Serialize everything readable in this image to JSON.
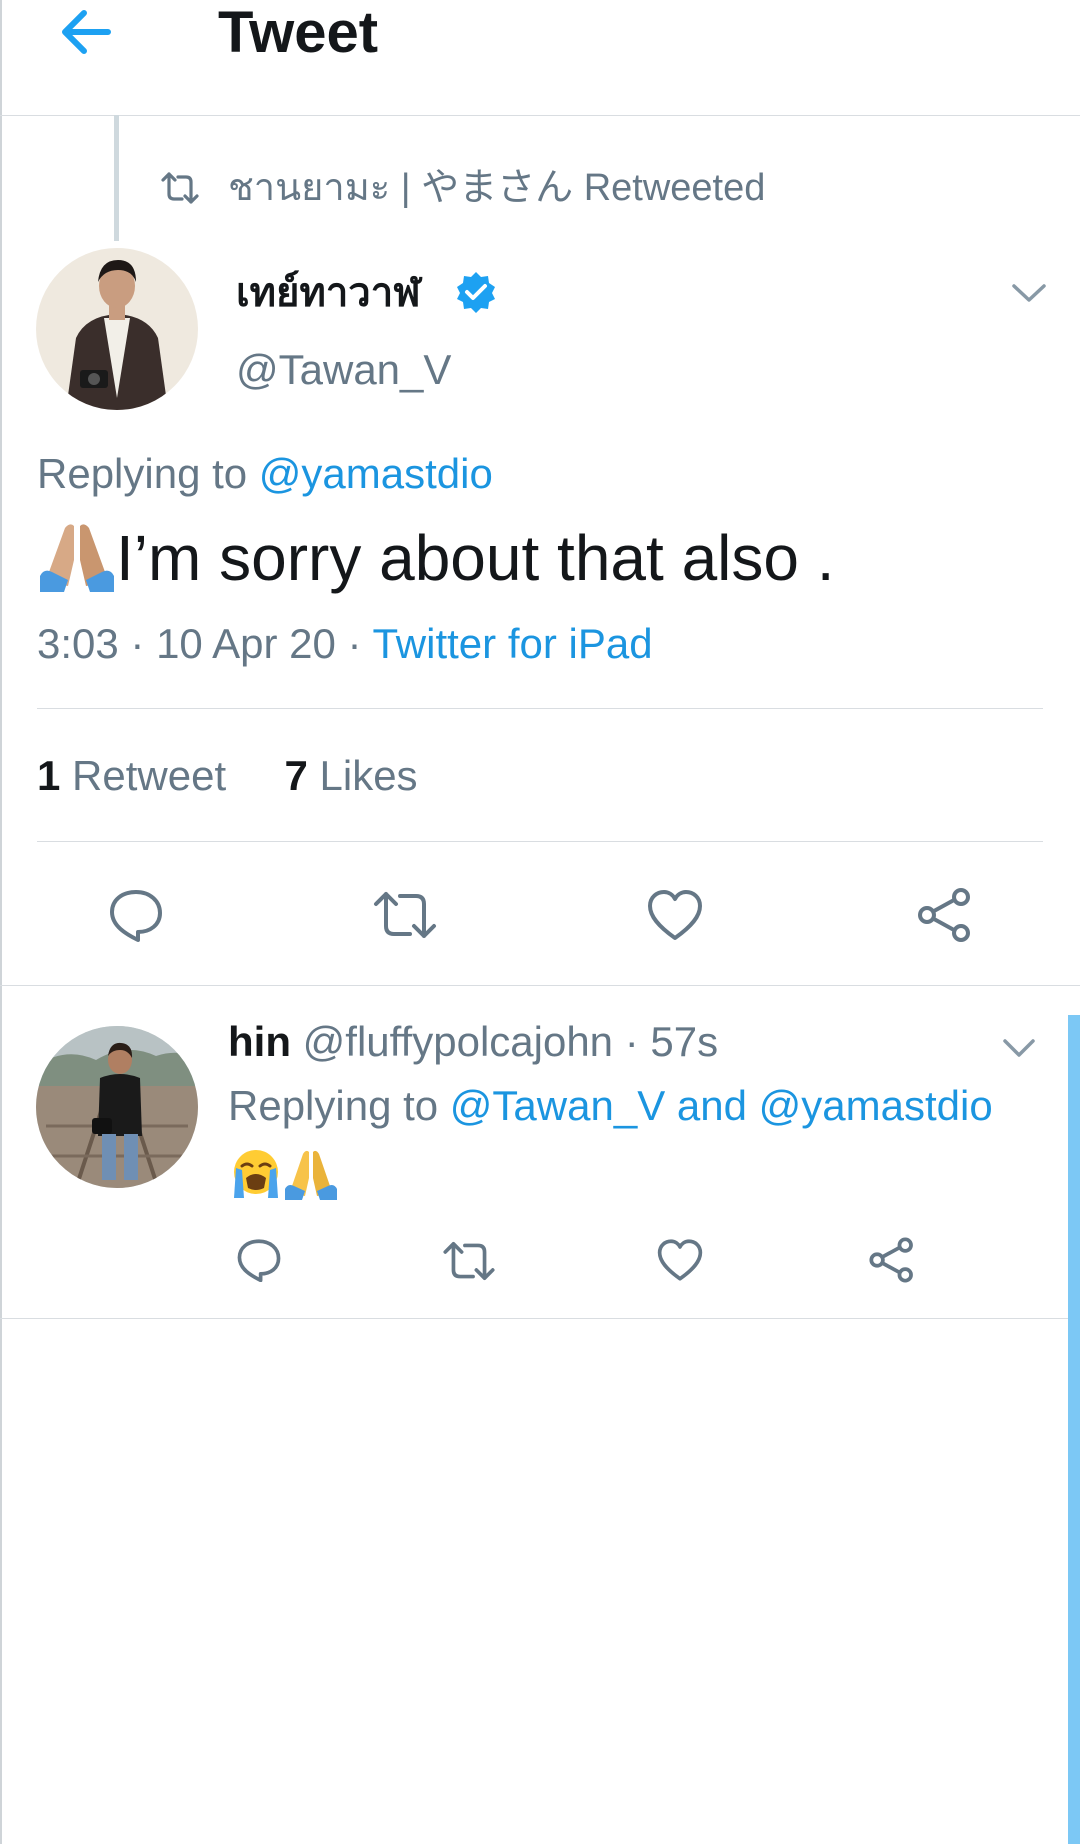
{
  "header": {
    "title": "Tweet",
    "back_icon": "arrow-left-icon"
  },
  "retweet_context": {
    "text": "ชานยามะ | やまさん Retweeted",
    "icon": "retweet-icon"
  },
  "author": {
    "name": "เทย์ทาวาฬ",
    "handle": "@Tawan_V",
    "verified": true
  },
  "tweet": {
    "replying_prefix": "Replying to",
    "replying_to": "@yamastdio",
    "emoji_icon": "folded-hands-icon",
    "text": "I’m sorry about that also .",
    "time": "3:03 · 10 Apr 20 ·",
    "source": "Twitter for iPad",
    "retweets_count": "1",
    "retweets_label": "Retweet",
    "likes_count": "7",
    "likes_label": "Likes"
  },
  "actions": [
    "reply-icon",
    "retweet-icon",
    "like-icon",
    "share-icon"
  ],
  "reply": {
    "name": "hin",
    "handle": "@fluffypolcajohn",
    "time": "· 57s",
    "replying_prefix": "Replying to",
    "replying_to_1": "@Tawan_V",
    "and_word": "and",
    "replying_to_2": "@yamastdio",
    "emojis": [
      "loudly-crying-face-icon",
      "folded-hands-icon"
    ]
  },
  "colors": {
    "link": "#1b95e0",
    "secondary": "#657786",
    "primary": "#14171a",
    "verified": "#1da1f2",
    "accent_bar": "#7cc8f5"
  }
}
